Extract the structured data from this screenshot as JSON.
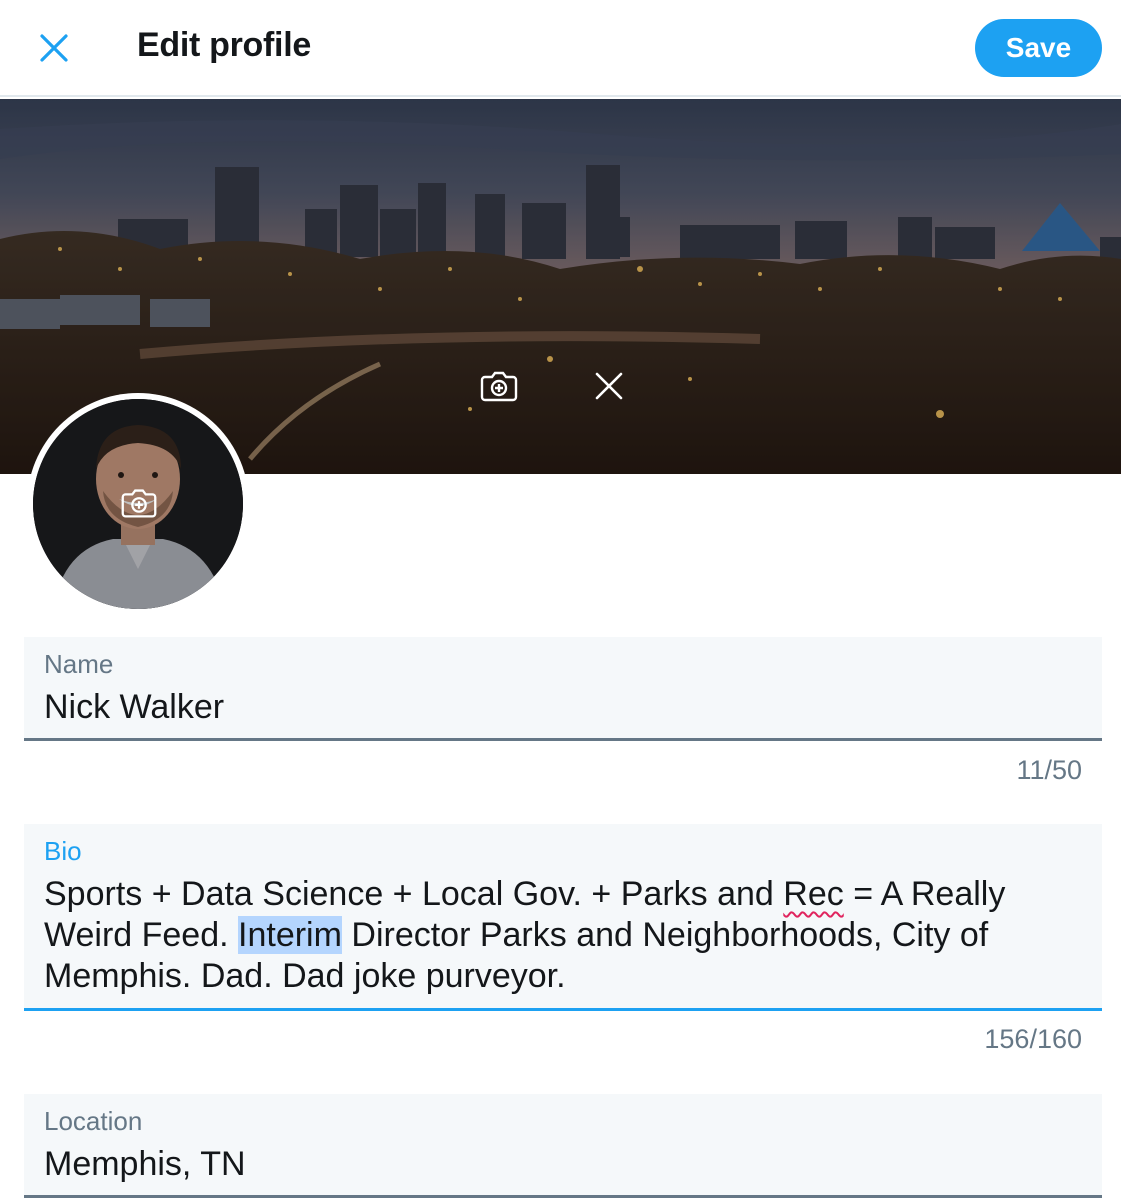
{
  "header": {
    "title": "Edit profile",
    "save_label": "Save",
    "close_icon": "close-icon"
  },
  "banner": {
    "add_photo_icon": "camera-add-icon",
    "remove_icon": "close-icon"
  },
  "avatar": {
    "add_photo_icon": "camera-add-icon"
  },
  "fields": {
    "name": {
      "label": "Name",
      "value": "Nick Walker",
      "counter": "11/50"
    },
    "bio": {
      "label": "Bio",
      "value_part1": "Sports + Data Science + Local Gov. + Parks and ",
      "value_misspelled": "Rec",
      "value_part2": " = A Really Weird Feed. ",
      "value_selected": "Interim",
      "value_part3": " Director Parks and Neighborhoods, City of Memphis. Dad. Dad joke purveyor.",
      "counter": "156/160"
    },
    "location": {
      "label": "Location",
      "value": "Memphis, TN"
    }
  },
  "colors": {
    "accent": "#1da1f2",
    "text_primary": "#14171a",
    "text_secondary": "#657786",
    "field_bg": "#f5f8fa"
  }
}
